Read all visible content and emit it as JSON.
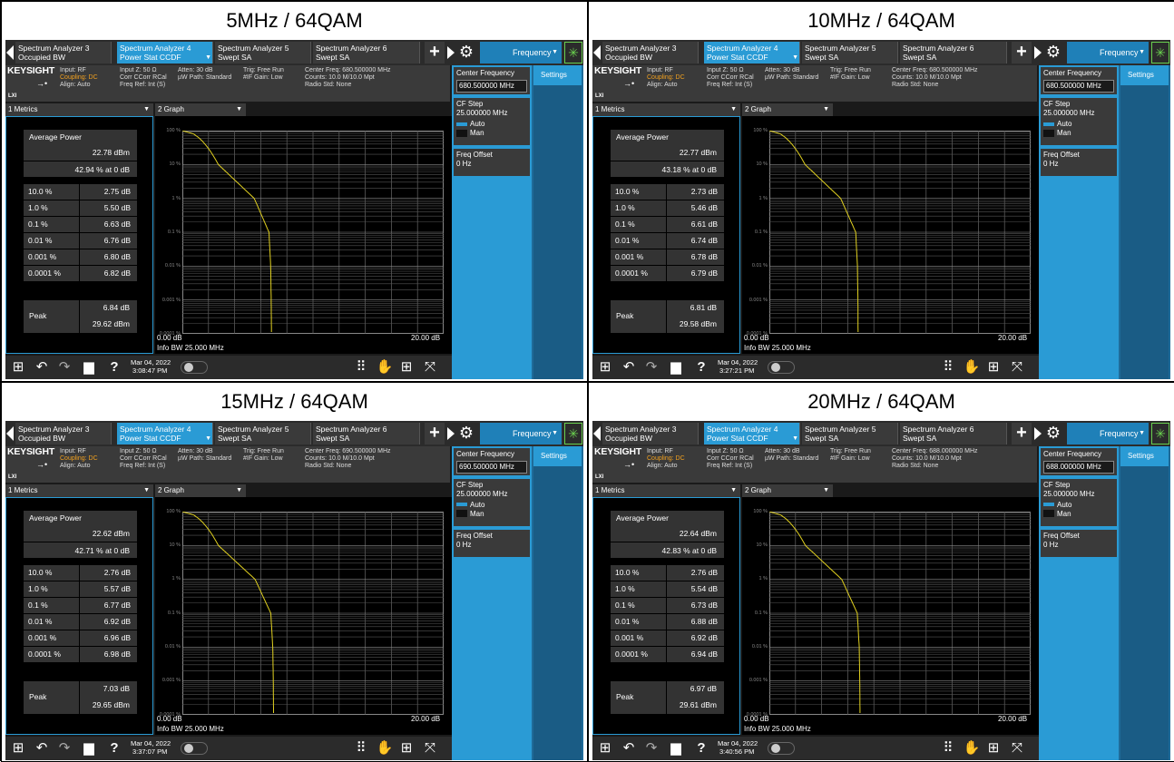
{
  "panels": [
    {
      "title": "5MHz / 64QAM",
      "center_freq_info": "Center Freq: 680.500000 MHz",
      "center_freq_value": "680.500000 MHz",
      "avg_power_dbm": "22.78 dBm",
      "avg_pct": "42.94 % at 0 dB",
      "stats": [
        {
          "p": "10.0 %",
          "v": "2.75 dB"
        },
        {
          "p": "1.0 %",
          "v": "5.50 dB"
        },
        {
          "p": "0.1 %",
          "v": "6.63 dB"
        },
        {
          "p": "0.01 %",
          "v": "6.76 dB"
        },
        {
          "p": "0.001 %",
          "v": "6.80 dB"
        },
        {
          "p": "0.0001 %",
          "v": "6.82 dB"
        }
      ],
      "peak_db": "6.84 dB",
      "peak_dbm": "29.62 dBm",
      "date": "Mar 04, 2022",
      "time": "3:08:47 PM",
      "curve": [
        [
          0,
          0
        ],
        [
          2.75,
          1
        ],
        [
          5.5,
          2
        ],
        [
          6.63,
          3
        ],
        [
          6.76,
          4
        ],
        [
          6.8,
          5
        ],
        [
          6.82,
          6
        ]
      ]
    },
    {
      "title": "10MHz / 64QAM",
      "center_freq_info": "Center Freq: 680.500000 MHz",
      "center_freq_value": "680.500000 MHz",
      "avg_power_dbm": "22.77 dBm",
      "avg_pct": "43.18 % at 0 dB",
      "stats": [
        {
          "p": "10.0 %",
          "v": "2.73 dB"
        },
        {
          "p": "1.0 %",
          "v": "5.46 dB"
        },
        {
          "p": "0.1 %",
          "v": "6.61 dB"
        },
        {
          "p": "0.01 %",
          "v": "6.74 dB"
        },
        {
          "p": "0.001 %",
          "v": "6.78 dB"
        },
        {
          "p": "0.0001 %",
          "v": "6.79 dB"
        }
      ],
      "peak_db": "6.81 dB",
      "peak_dbm": "29.58 dBm",
      "date": "Mar 04, 2022",
      "time": "3:27:21 PM",
      "curve": [
        [
          0,
          0
        ],
        [
          2.73,
          1
        ],
        [
          5.46,
          2
        ],
        [
          6.61,
          3
        ],
        [
          6.74,
          4
        ],
        [
          6.78,
          5
        ],
        [
          6.79,
          6
        ]
      ]
    },
    {
      "title": "15MHz / 64QAM",
      "center_freq_info": "Center Freq: 690.500000 MHz",
      "center_freq_value": "690.500000 MHz",
      "avg_power_dbm": "22.62 dBm",
      "avg_pct": "42.71 % at 0 dB",
      "stats": [
        {
          "p": "10.0 %",
          "v": "2.76 dB"
        },
        {
          "p": "1.0 %",
          "v": "5.57 dB"
        },
        {
          "p": "0.1 %",
          "v": "6.77 dB"
        },
        {
          "p": "0.01 %",
          "v": "6.92 dB"
        },
        {
          "p": "0.001 %",
          "v": "6.96 dB"
        },
        {
          "p": "0.0001 %",
          "v": "6.98 dB"
        }
      ],
      "peak_db": "7.03 dB",
      "peak_dbm": "29.65 dBm",
      "date": "Mar 04, 2022",
      "time": "3:37:07 PM",
      "curve": [
        [
          0,
          0
        ],
        [
          2.76,
          1
        ],
        [
          5.57,
          2
        ],
        [
          6.77,
          3
        ],
        [
          6.92,
          4
        ],
        [
          6.96,
          5
        ],
        [
          6.98,
          6
        ]
      ]
    },
    {
      "title": "20MHz / 64QAM",
      "center_freq_info": "Center Freq: 688.000000 MHz",
      "center_freq_value": "688.000000 MHz",
      "avg_power_dbm": "22.64 dBm",
      "avg_pct": "42.83 % at 0 dB",
      "stats": [
        {
          "p": "10.0 %",
          "v": "2.76 dB"
        },
        {
          "p": "1.0 %",
          "v": "5.54 dB"
        },
        {
          "p": "0.1 %",
          "v": "6.73 dB"
        },
        {
          "p": "0.01 %",
          "v": "6.88 dB"
        },
        {
          "p": "0.001 %",
          "v": "6.92 dB"
        },
        {
          "p": "0.0001 %",
          "v": "6.94 dB"
        }
      ],
      "peak_db": "6.97 dB",
      "peak_dbm": "29.61 dBm",
      "date": "Mar 04, 2022",
      "time": "3:40:56 PM",
      "curve": [
        [
          0,
          0
        ],
        [
          2.76,
          1
        ],
        [
          5.54,
          2
        ],
        [
          6.73,
          3
        ],
        [
          6.88,
          4
        ],
        [
          6.92,
          5
        ],
        [
          6.94,
          6
        ]
      ]
    }
  ],
  "common": {
    "tabs": [
      {
        "line1": "Spectrum Analyzer 3",
        "line2": "Occupied BW"
      },
      {
        "line1": "Spectrum Analyzer 4",
        "line2": "Power Stat CCDF"
      },
      {
        "line1": "Spectrum Analyzer 5",
        "line2": "Swept SA"
      },
      {
        "line1": "Spectrum Analyzer 6",
        "line2": "Swept SA"
      }
    ],
    "active_tab": 1,
    "plus": "+",
    "freq_menu": "Frequency",
    "logo": "KEYSIGHT",
    "lxi": "LXI",
    "input": "Input: RF",
    "coupling": "Coupling: DC",
    "align": "Align: Auto",
    "input_z": "Input Z: 50 Ω",
    "corr": "Corr CCorr RCal",
    "freq_ref": "Freq Ref: Int (S)",
    "atten": "Atten: 30 dB",
    "uw_path": "µW Path: Standard",
    "trig": "Trig: Free Run",
    "if_gain": "#IF Gain: Low",
    "counts": "Counts: 10.0 M/10.0 Mpt",
    "radio_std": "Radio Std: None",
    "metrics_tab": "1 Metrics",
    "graph_tab": "2 Graph",
    "avg_power_label": "Average Power",
    "peak_label": "Peak",
    "y_ticks": [
      "100 %",
      "10 %",
      "1 %",
      "0.1 %",
      "0.01 %",
      "0.001 %",
      "0.0001 %"
    ],
    "x_start": "0.00 dB",
    "x_end": "20.00 dB",
    "info_bw": "Info BW 25.000 MHz",
    "cf_label": "Center Frequency",
    "settings": "Settings",
    "cf_step_label": "CF Step",
    "cf_step_value": "25.000000 MHz",
    "auto": "Auto",
    "man": "Man",
    "freq_offset_label": "Freq Offset",
    "freq_offset_value": "0 Hz",
    "x_range_db": [
      0,
      20
    ],
    "trace_color": "#e0d020",
    "accent": "#2a9bd5"
  }
}
